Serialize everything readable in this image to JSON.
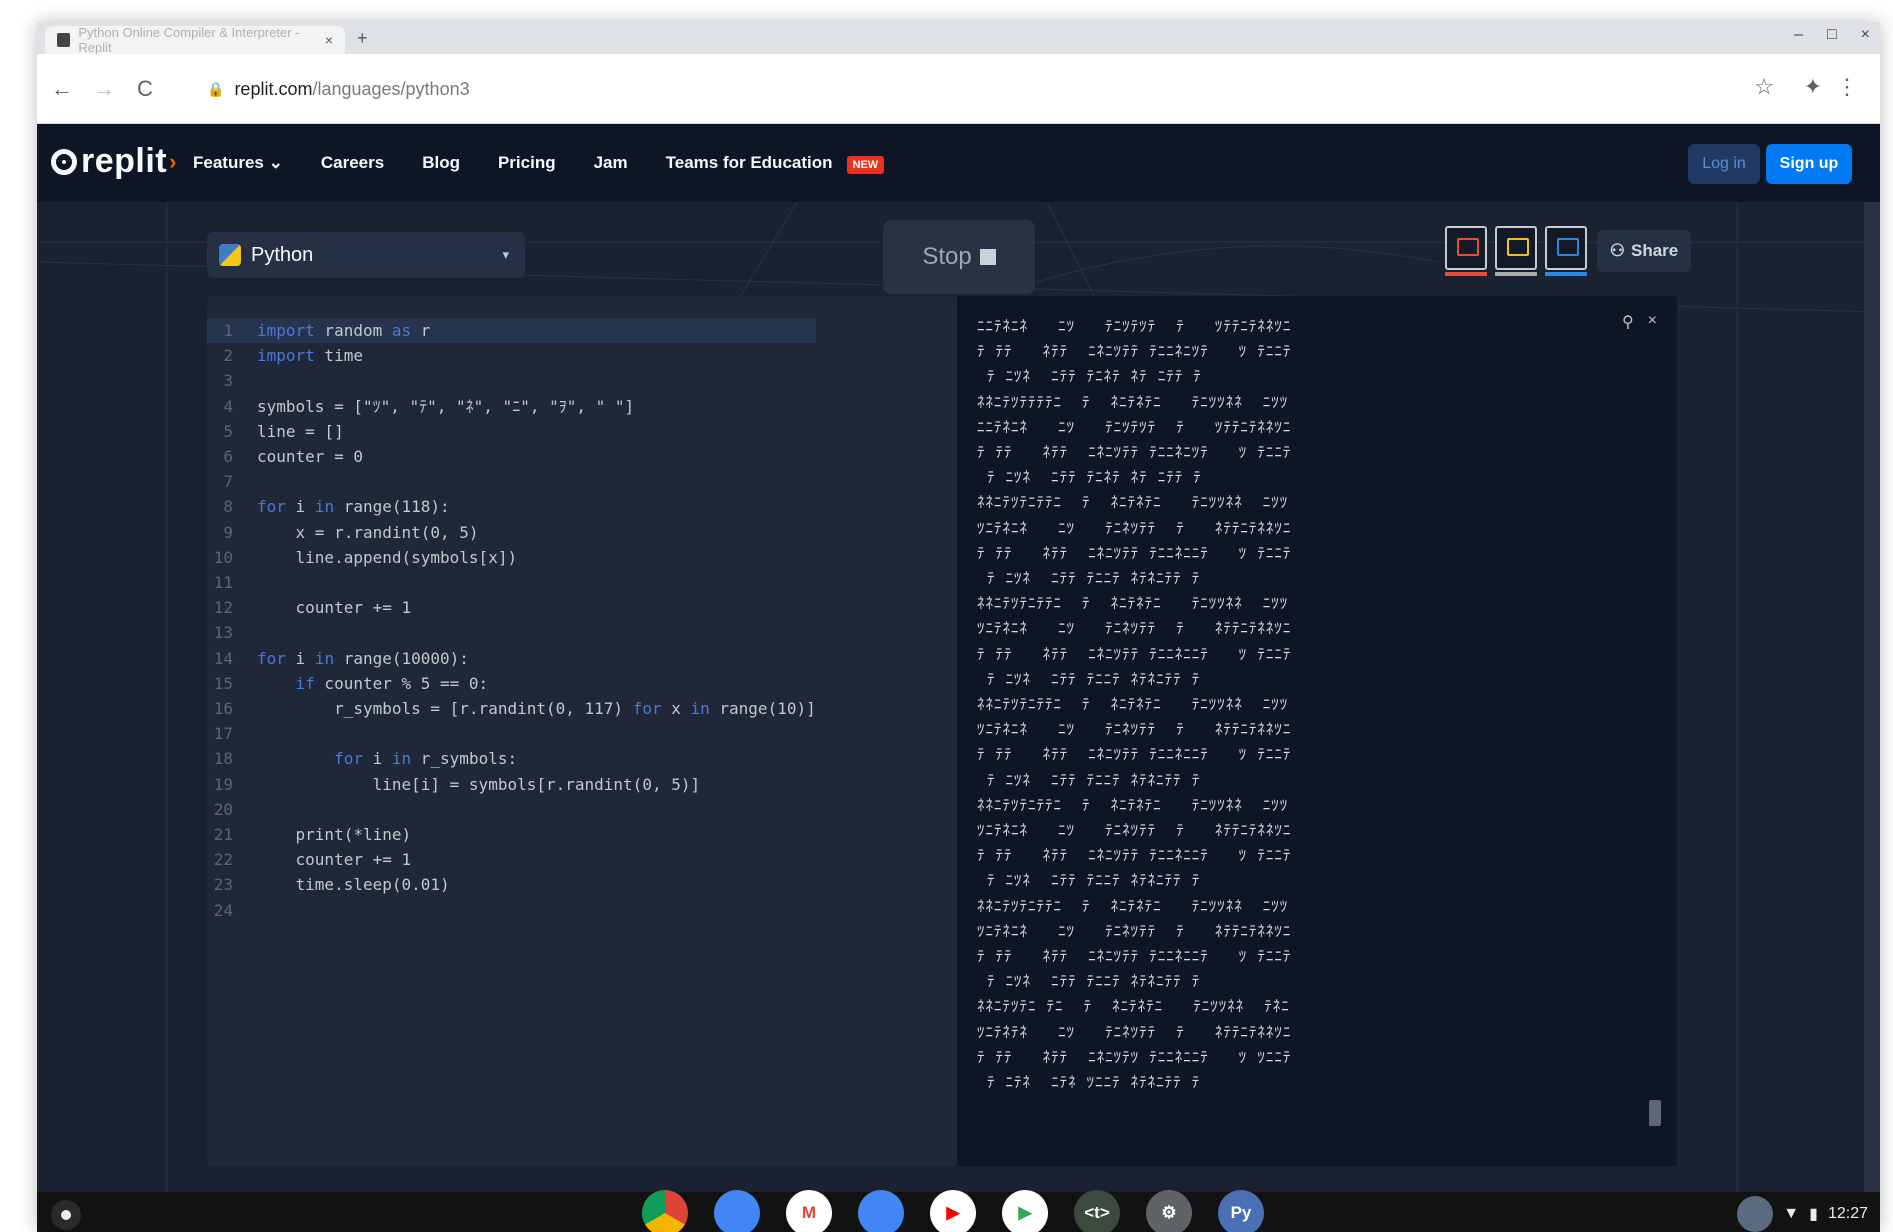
{
  "browser": {
    "tab_title": "Python Online Compiler & Interpreter - Replit",
    "tab_close": "×",
    "new_tab": "+",
    "url_domain": "replit.com",
    "url_path": "/languages/python3",
    "back": "←",
    "forward": "→",
    "reload": "C",
    "star": "☆",
    "extensions": "✦",
    "menu": "⋮",
    "win_minimize": "–",
    "win_maximize": "□",
    "win_close": "×"
  },
  "site_nav": {
    "logo": "replit",
    "links": [
      "Features",
      "Careers",
      "Blog",
      "Pricing",
      "Jam",
      "Teams for Education"
    ],
    "features_chevron": "⌄",
    "new_badge": "NEW",
    "login": "Log in",
    "signup": "Sign up"
  },
  "workspace": {
    "language": "Python",
    "language_chevron": "▾",
    "stop_label": "Stop",
    "share_label": "Share"
  },
  "editor": {
    "lines": [
      "import random as r",
      "import time",
      "",
      "symbols = [\"ﾂ\", \"ﾃ\", \"ﾈ\", \"ﾆ\", \"ｦ\", \" \"]",
      "line = []",
      "counter = 0",
      "",
      "for i in range(118):",
      "    x = r.randint(0, 5)",
      "    line.append(symbols[x])",
      "",
      "    counter += 1",
      "",
      "for i in range(10000):",
      "    if counter % 5 == 0:",
      "        r_symbols = [r.randint(0, 117) for x in range(10)]",
      "",
      "        for i in r_symbols:",
      "            line[i] = symbols[r.randint(0, 5)]",
      "",
      "    print(*line)",
      "    counter += 1",
      "    time.sleep(0.01)",
      ""
    ]
  },
  "console": {
    "search_icon": "⚲",
    "clear_icon": "×",
    "output": [
      "ﾆﾆﾃﾈﾆﾈ   ﾆﾂ   ﾃﾆﾂﾃﾂﾃ  ﾃ   ﾂﾃﾃﾆﾃﾈﾈﾂﾆ",
      "ﾃ ﾃﾃ   ﾈﾃﾃ  ﾆﾈﾆﾂﾃﾃ ﾃﾆﾆﾈﾆﾂﾃ   ﾂ ﾃﾆﾆﾃ",
      " ﾃ ﾆﾂﾈ  ﾆﾃﾃ ﾃﾆﾈﾃ ﾈﾃ ﾆﾃﾃ ﾃ",
      "ﾈﾈﾆﾃﾂﾃﾃﾃﾃﾆ  ﾃ  ﾈﾆﾃﾈﾃﾆ   ﾃﾆﾂﾂﾈﾈ  ﾆﾂﾂ",
      "ﾆﾆﾃﾈﾆﾈ   ﾆﾂ   ﾃﾆﾂﾃﾂﾃ  ﾃ   ﾂﾃﾃﾆﾃﾈﾈﾂﾆ",
      "ﾃ ﾃﾃ   ﾈﾃﾃ  ﾆﾈﾆﾂﾃﾃ ﾃﾆﾆﾈﾆﾂﾃ   ﾂ ﾃﾆﾆﾃ",
      " ﾃ ﾆﾂﾈ  ﾆﾃﾃ ﾃﾆﾈﾃ ﾈﾃ ﾆﾃﾃ ﾃ",
      "ﾈﾈﾆﾃﾂﾃﾆﾃﾃﾆ  ﾃ  ﾈﾆﾃﾈﾃﾆ   ﾃﾆﾂﾂﾈﾈ  ﾆﾂﾂ",
      "ﾂﾆﾃﾈﾆﾈ   ﾆﾂ   ﾃﾆﾈﾂﾃﾃ  ﾃ   ﾈﾃﾃﾆﾃﾈﾈﾂﾆ",
      "ﾃ ﾃﾃ   ﾈﾃﾃ  ﾆﾈﾆﾂﾃﾃ ﾃﾆﾆﾈﾆﾆﾃ   ﾂ ﾃﾆﾆﾃ",
      " ﾃ ﾆﾂﾈ  ﾆﾃﾃ ﾃﾆﾆﾃ ﾈﾃﾈﾆﾃﾃ ﾃ",
      "ﾈﾈﾆﾃﾂﾃﾆﾃﾃﾆ  ﾃ  ﾈﾆﾃﾈﾃﾆ   ﾃﾆﾂﾂﾈﾈ  ﾆﾂﾂ",
      "ﾂﾆﾃﾈﾆﾈ   ﾆﾂ   ﾃﾆﾈﾂﾃﾃ  ﾃ   ﾈﾃﾃﾆﾃﾈﾈﾂﾆ",
      "ﾃ ﾃﾃ   ﾈﾃﾃ  ﾆﾈﾆﾂﾃﾃ ﾃﾆﾆﾈﾆﾆﾃ   ﾂ ﾃﾆﾆﾃ",
      " ﾃ ﾆﾂﾈ  ﾆﾃﾃ ﾃﾆﾆﾃ ﾈﾃﾈﾆﾃﾃ ﾃ",
      "ﾈﾈﾆﾃﾂﾃﾆﾃﾃﾆ  ﾃ  ﾈﾆﾃﾈﾃﾆ   ﾃﾆﾂﾂﾈﾈ  ﾆﾂﾂ",
      "ﾂﾆﾃﾈﾆﾈ   ﾆﾂ   ﾃﾆﾈﾂﾃﾃ  ﾃ   ﾈﾃﾃﾆﾃﾈﾈﾂﾆ",
      "ﾃ ﾃﾃ   ﾈﾃﾃ  ﾆﾈﾆﾂﾃﾃ ﾃﾆﾆﾈﾆﾆﾃ   ﾂ ﾃﾆﾆﾃ",
      " ﾃ ﾆﾂﾈ  ﾆﾃﾃ ﾃﾆﾆﾃ ﾈﾃﾈﾆﾃﾃ ﾃ",
      "ﾈﾈﾆﾃﾂﾃﾆﾃﾃﾆ  ﾃ  ﾈﾆﾃﾈﾃﾆ   ﾃﾆﾂﾂﾈﾈ  ﾆﾂﾂ",
      "ﾂﾆﾃﾈﾆﾈ   ﾆﾂ   ﾃﾆﾈﾂﾃﾃ  ﾃ   ﾈﾃﾃﾆﾃﾈﾈﾂﾆ",
      "ﾃ ﾃﾃ   ﾈﾃﾃ  ﾆﾈﾆﾂﾃﾃ ﾃﾆﾆﾈﾆﾆﾃ   ﾂ ﾃﾆﾆﾃ",
      " ﾃ ﾆﾂﾈ  ﾆﾃﾃ ﾃﾆﾆﾃ ﾈﾃﾈﾆﾃﾃ ﾃ",
      "ﾈﾈﾆﾃﾂﾃﾆﾃﾃﾆ  ﾃ  ﾈﾆﾃﾈﾃﾆ   ﾃﾆﾂﾂﾈﾈ  ﾆﾂﾂ",
      "ﾂﾆﾃﾈﾆﾈ   ﾆﾂ   ﾃﾆﾈﾂﾃﾃ  ﾃ   ﾈﾃﾃﾆﾃﾈﾈﾂﾆ",
      "ﾃ ﾃﾃ   ﾈﾃﾃ  ﾆﾈﾆﾂﾃﾃ ﾃﾆﾆﾈﾆﾆﾃ   ﾂ ﾃﾆﾆﾃ",
      " ﾃ ﾆﾂﾈ  ﾆﾃﾃ ﾃﾆﾆﾃ ﾈﾃﾈﾆﾃﾃ ﾃ",
      "ﾈﾈﾆﾃﾂﾃﾆ ﾃﾆ  ﾃ  ﾈﾆﾃﾈﾃﾆ   ﾃﾆﾂﾂﾈﾈ  ﾃﾈﾆ",
      "ﾂﾆﾃﾈﾃﾈ   ﾆﾂ   ﾃﾆﾈﾂﾃﾃ  ﾃ   ﾈﾃﾃﾆﾃﾈﾈﾂﾆ",
      "ﾃ ﾃﾃ   ﾈﾃﾃ  ﾆﾈﾆﾂﾃﾂ ﾃﾆﾆﾈﾆﾆﾃ   ﾂ ﾂﾆﾆﾃ",
      " ﾃ ﾆﾃﾈ  ﾆﾃﾈ ﾂﾆﾆﾃ ﾈﾃﾈﾆﾃﾃ ﾃ"
    ]
  },
  "shelf": {
    "apps": [
      {
        "name": "chrome",
        "glyph": "",
        "color": "#db4437"
      },
      {
        "name": "files",
        "glyph": "",
        "color": "#4285f4"
      },
      {
        "name": "gmail",
        "glyph": "M",
        "color": "#ffffff"
      },
      {
        "name": "docs",
        "glyph": "",
        "color": "#4285f4"
      },
      {
        "name": "youtube",
        "glyph": "▶",
        "color": "#ff0000"
      },
      {
        "name": "play-store",
        "glyph": "▶",
        "color": "#34a853"
      },
      {
        "name": "dev-app",
        "glyph": "<t>",
        "color": "#3c4a3e"
      },
      {
        "name": "settings",
        "glyph": "⚙",
        "color": "#5f6368"
      },
      {
        "name": "python-app",
        "glyph": "Py",
        "color": "#4a6fb5"
      }
    ],
    "time": "12:27"
  }
}
